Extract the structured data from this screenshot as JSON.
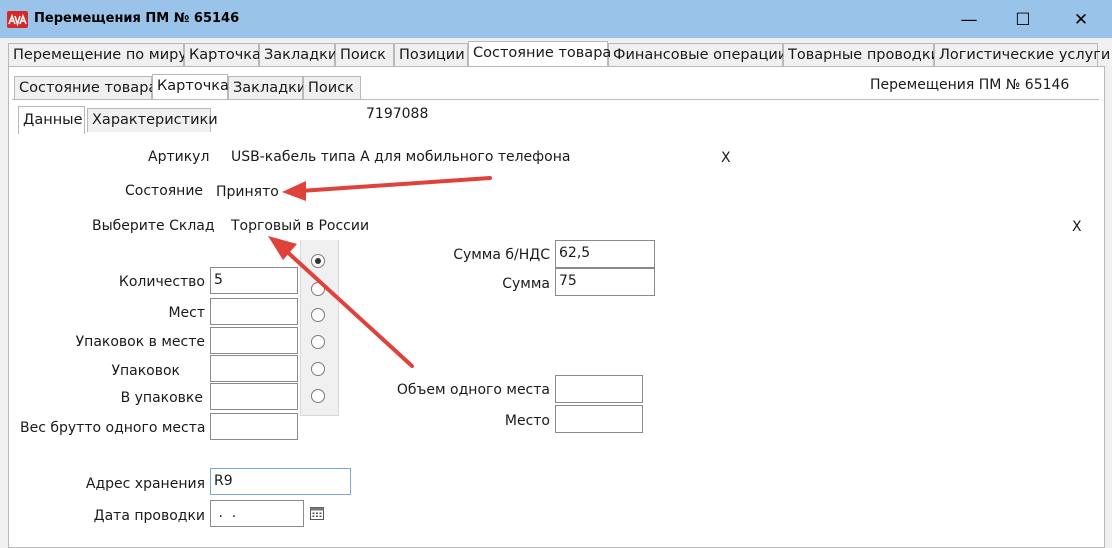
{
  "window": {
    "title": "Перемещения ПМ № 65146",
    "minimize": "—",
    "maximize": "☐",
    "close": "✕"
  },
  "main_tabs": [
    {
      "label": "Перемещение по миру"
    },
    {
      "label": "Карточка"
    },
    {
      "label": "Закладки"
    },
    {
      "label": "Поиск"
    },
    {
      "label": "Позиции"
    },
    {
      "label": "Состояние товара"
    },
    {
      "label": "Финансовые операции"
    },
    {
      "label": "Товарные проводки"
    },
    {
      "label": "Логистические услуги"
    }
  ],
  "sub_tabs": [
    {
      "label": "Состояние товара"
    },
    {
      "label": "Карточка"
    },
    {
      "label": "Закладки"
    },
    {
      "label": "Поиск"
    }
  ],
  "inner_tabs": [
    {
      "label": "Данные"
    },
    {
      "label": "Характеристики"
    }
  ],
  "doc_header": "Перемещения ПМ № 65146",
  "record_id": "7197088",
  "form": {
    "article_label": "Артикул",
    "article_value": "USB-кабель типа А для мобильного телефона",
    "clear_x": "X",
    "state_label": "Состояние",
    "state_value": "Принято",
    "warehouse_label": "Выберите Склад",
    "warehouse_value": "Торговый в России",
    "quantity_label": "Количество",
    "quantity_value": "5",
    "places_label": "Мест",
    "places_value": "",
    "packs_in_place_label": "Упаковок в месте",
    "packs_in_place_value": "",
    "packs_label": "Упаковок",
    "packs_value": "",
    "in_pack_label": "В упаковке",
    "in_pack_value": "",
    "gross_weight_label": "Вес брутто одного места",
    "gross_weight_value": "",
    "sum_no_vat_label": "Сумма  б/НДС",
    "sum_no_vat_value": "62,5",
    "sum_label": "Сумма",
    "sum_value": "75",
    "volume_label": "Объем одного места",
    "volume_value": "",
    "place_label": "Место",
    "place_value": "",
    "storage_address_label": "Адрес хранения",
    "storage_address_value": "R9",
    "posting_date_label": "Дата проводки",
    "posting_date_value": " .  ."
  },
  "colors": {
    "titlebar": "#99c3e8",
    "arrow": "#e0413a",
    "app_icon": "#d62828"
  }
}
